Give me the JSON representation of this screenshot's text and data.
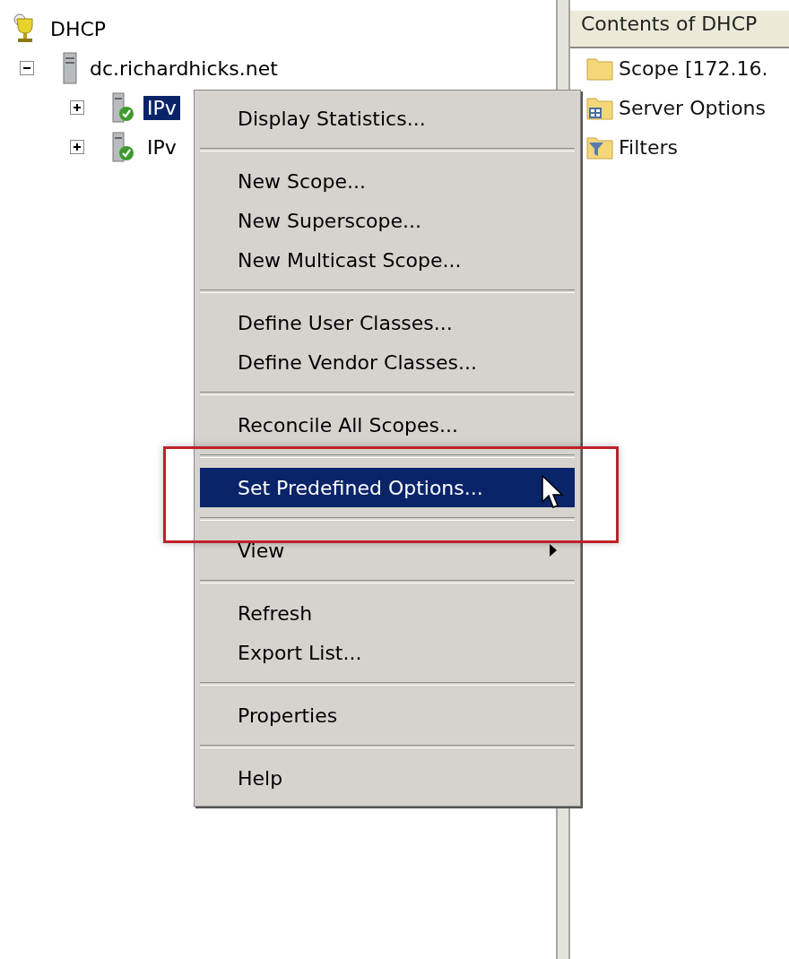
{
  "tree": [
    {
      "label": "DHCP",
      "selected": false,
      "children": [
        {
          "label": "dc.richardhicks.net",
          "expanded": true,
          "selected": false,
          "children": [
            {
              "label": "IPv",
              "expanded": false,
              "selected": true
            },
            {
              "label": "IPv",
              "expanded": false,
              "selected": false
            }
          ]
        }
      ]
    }
  ],
  "contents": {
    "header": "Contents of DHCP",
    "items": [
      {
        "label": "Scope [172.16."
      },
      {
        "label": "Server Options"
      },
      {
        "label": "Filters"
      }
    ]
  },
  "context_menu": [
    {
      "kind": "item",
      "label": "Display Statistics...",
      "selected": false,
      "submenu": false
    },
    {
      "kind": "separator"
    },
    {
      "kind": "item",
      "label": "New Scope...",
      "selected": false,
      "submenu": false
    },
    {
      "kind": "item",
      "label": "New Superscope...",
      "selected": false,
      "submenu": false
    },
    {
      "kind": "item",
      "label": "New Multicast Scope...",
      "selected": false,
      "submenu": false
    },
    {
      "kind": "separator"
    },
    {
      "kind": "item",
      "label": "Define User Classes...",
      "selected": false,
      "submenu": false
    },
    {
      "kind": "item",
      "label": "Define Vendor Classes...",
      "selected": false,
      "submenu": false
    },
    {
      "kind": "separator"
    },
    {
      "kind": "item",
      "label": "Reconcile All Scopes...",
      "selected": false,
      "submenu": false
    },
    {
      "kind": "separator"
    },
    {
      "kind": "item",
      "label": "Set Predefined Options...",
      "selected": true,
      "submenu": false
    },
    {
      "kind": "separator"
    },
    {
      "kind": "item",
      "label": "View",
      "selected": false,
      "submenu": true
    },
    {
      "kind": "separator"
    },
    {
      "kind": "item",
      "label": "Refresh",
      "selected": false,
      "submenu": false
    },
    {
      "kind": "item",
      "label": "Export List...",
      "selected": false,
      "submenu": false
    },
    {
      "kind": "separator"
    },
    {
      "kind": "item",
      "label": "Properties",
      "selected": false,
      "submenu": false
    },
    {
      "kind": "separator"
    },
    {
      "kind": "item",
      "label": "Help",
      "selected": false,
      "submenu": false
    }
  ]
}
